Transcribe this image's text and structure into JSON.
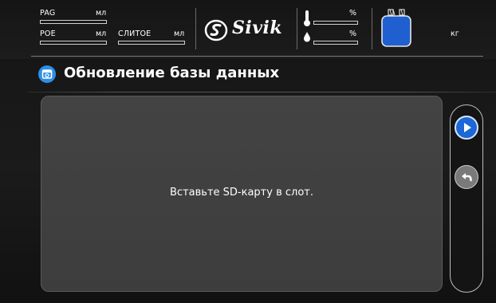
{
  "status_bar": {
    "pag_label": "PAG",
    "pag_unit": "мл",
    "poe_label": "POE",
    "poe_unit": "мл",
    "drain_label": "СЛИТОЕ",
    "drain_unit": "мл",
    "brand": "Sivik",
    "level_unit_top": "%",
    "level_unit_bottom": "%",
    "tank_unit": "кг"
  },
  "header": {
    "title": "Обновление базы данных",
    "icon": "database-update-icon"
  },
  "main": {
    "message": "Вставьте SD-карту в слот."
  },
  "sidenav": {
    "next_icon": "play-next-icon",
    "back_icon": "back-arrow-icon"
  },
  "colors": {
    "accent": "#1d67d6",
    "title_icon": "#2d8fe6",
    "tank_fill": "#1f5fd0",
    "panel": "#404040"
  }
}
